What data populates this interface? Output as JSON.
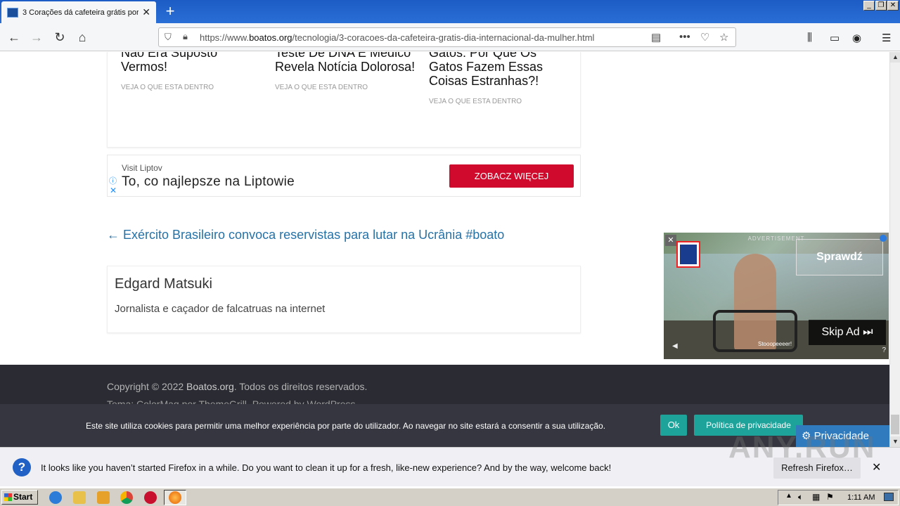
{
  "browser": {
    "tab_title": "3 Corações dá cafeteira grátis por",
    "url_prefix": "https://www.",
    "url_domain": "boatos.org",
    "url_path": "/tecnologia/3-coracoes-da-cafeteira-gratis-dia-internacional-da-mulher.html",
    "icons": [
      "back-icon",
      "forward-icon",
      "reload-icon",
      "home-icon",
      "shield-icon",
      "lock-icon",
      "reader-icon",
      "more-icon",
      "pocket-icon",
      "bookmark-star-icon",
      "library-icon",
      "sidebar-icon",
      "account-icon",
      "menu-icon"
    ]
  },
  "related": [
    {
      "title": "Não Era Suposto Vermos!",
      "cta": "VEJA O QUE ESTA DENTRO"
    },
    {
      "title": "Teste De DNA E Médico Revela Notícia Dolorosa!",
      "cta": "VEJA O QUE ESTA DENTRO"
    },
    {
      "title": "Gatos: Por Que Os Gatos Fazem Essas Coisas Estranhas?!",
      "cta": "VEJA O QUE ESTA DENTRO"
    }
  ],
  "ad": {
    "sponsor": "Visit Liptov",
    "headline": "To, co najlepsze na Liptowie",
    "cta": "ZOBACZ WIĘCEJ",
    "cta_color": "#cf0a2c"
  },
  "prev_post": "← Exército Brasileiro convoca reservistas para lutar na Ucrânia #boato",
  "author": {
    "name": "Edgard Matsuki",
    "bio": "Jornalista e caçador de falcatruas na internet"
  },
  "video_ad": {
    "label": "ADVERTISEMENT",
    "cta": "Sprawdź",
    "skip": "Skip Ad ⏭",
    "caption": "Stooopeeeer!",
    "close": "✕"
  },
  "footer": {
    "copyright_prefix": "Copyright © 2022 ",
    "site": "Boatos.org",
    "copyright_suffix": ". Todos os direitos reservados.",
    "credit": "Tema: ColorMag por ThemeGrill. Powered by WordPress."
  },
  "cookie": {
    "text": "Este site utiliza cookies para permitir uma melhor experiência por parte do utilizador. Ao navegar no site estará a consentir a sua utilização.",
    "ok": "Ok",
    "policy": "Política de privacidade",
    "privacy_tab": "⚙ Privacidade",
    "accent": "#1ea39a"
  },
  "notification": {
    "text": "It looks like you haven’t started Firefox in a while. Do you want to clean it up for a fresh, like-new experience? And by the way, welcome back!",
    "button": "Refresh Firefox…",
    "close": "✕"
  },
  "taskbar": {
    "start": "Start",
    "clock": "1:11 AM"
  },
  "watermark": "ANY.RUN"
}
